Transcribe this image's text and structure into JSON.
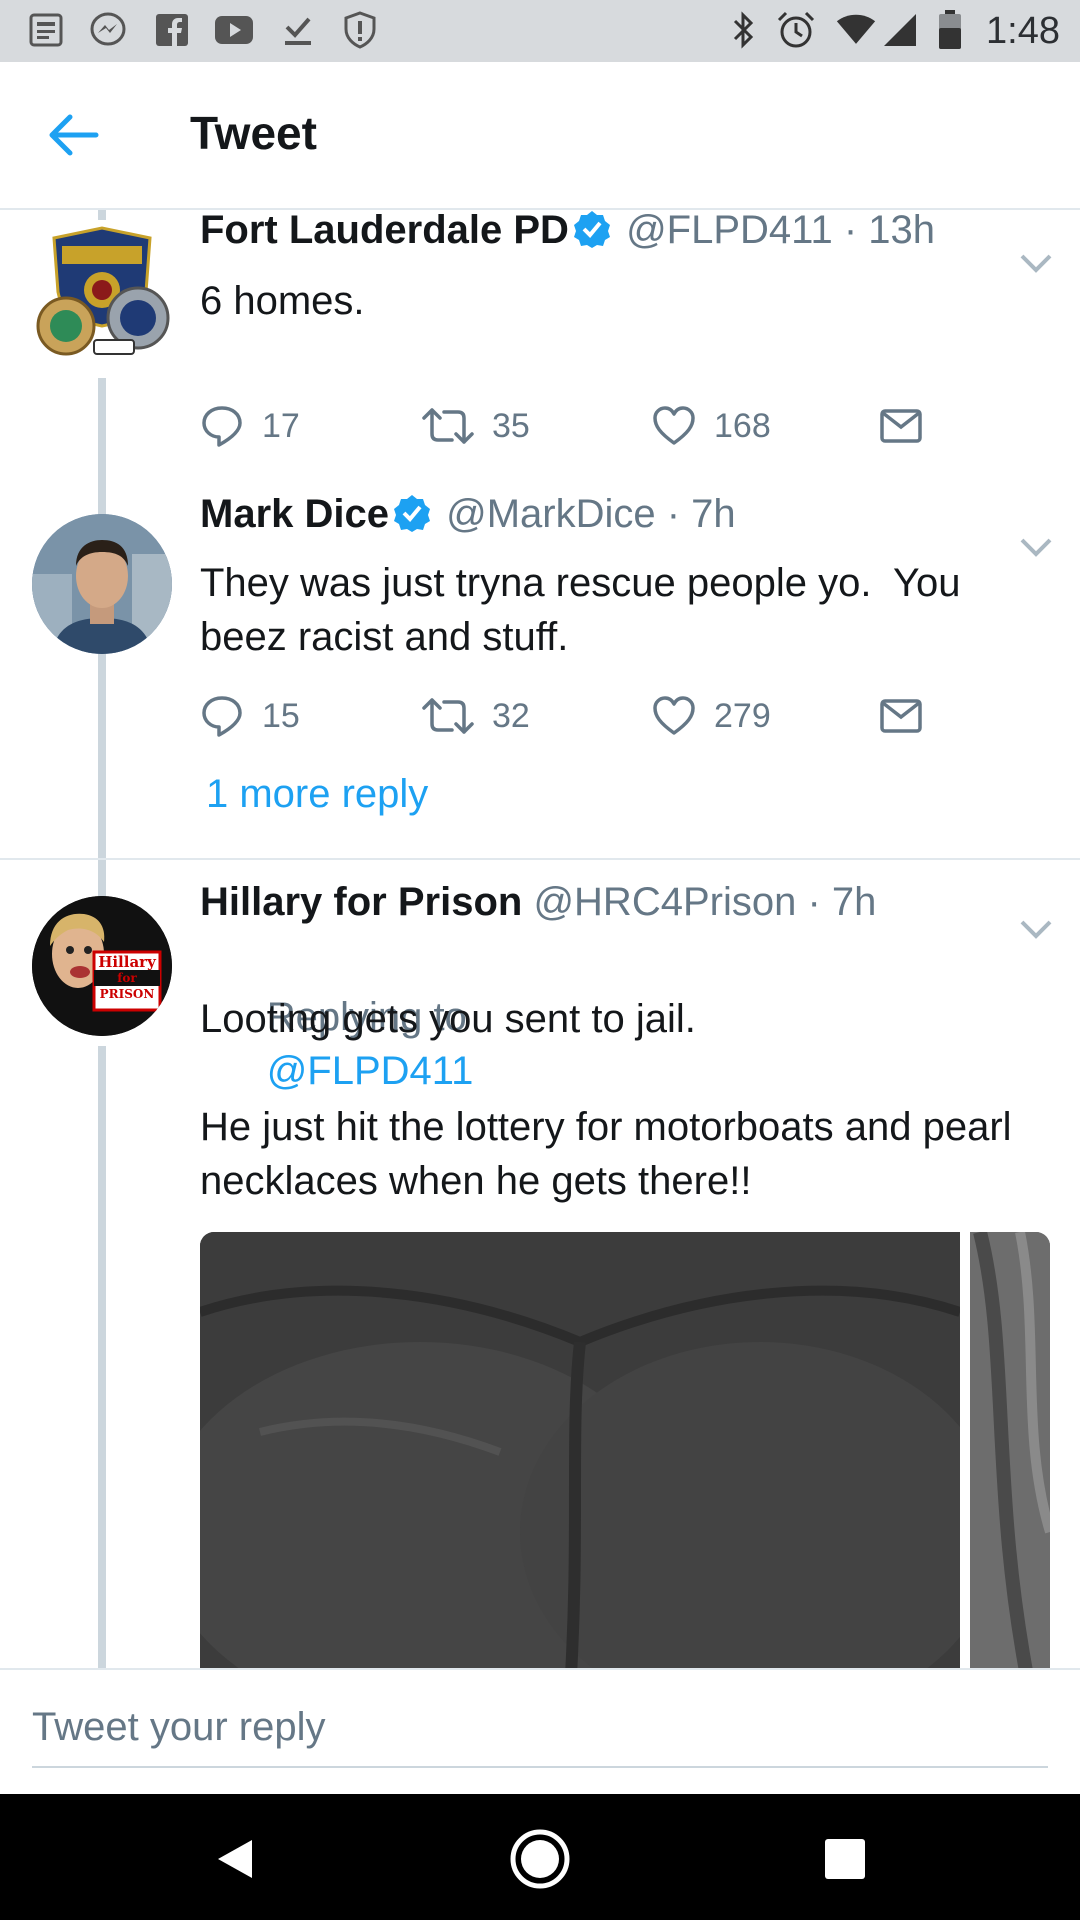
{
  "status_bar": {
    "time": "1:48",
    "left_icons": [
      "news-icon",
      "messenger-icon",
      "facebook-icon",
      "youtube-icon",
      "download-done-icon",
      "shield-alert-icon"
    ],
    "right_icons": [
      "bluetooth-icon",
      "alarm-icon",
      "wifi-icon",
      "signal-icon",
      "battery-icon"
    ]
  },
  "header": {
    "title": "Tweet"
  },
  "colors": {
    "accent": "#1da1f2",
    "secondary_text": "#657786",
    "thread_line": "#ccd6dd",
    "verified": "#1da1f2"
  },
  "tweets": [
    {
      "name": "Fort Lauderdale PD",
      "verified": true,
      "handle": "@FLPD411",
      "time": "· 13h",
      "text": "6 homes.",
      "replies": "17",
      "retweets": "35",
      "likes": "168"
    },
    {
      "name": "Mark Dice",
      "verified": true,
      "handle": "@MarkDice",
      "time": "· 7h",
      "text": "They was just tryna rescue people yo.  You beez racist and stuff.",
      "replies": "15",
      "retweets": "32",
      "likes": "279"
    },
    {
      "name": "Hillary for Prison",
      "verified": false,
      "handle": "@HRC4Prison",
      "time": "· 7h",
      "replying_label": "Replying to",
      "replying_to": "@FLPD411",
      "text": "Looting gets you sent to jail.\n\nHe just hit the lottery for motorboats and pearl necklaces when he gets there!!",
      "avatar_badge": [
        "Hillary",
        "for",
        "PRISON"
      ]
    }
  ],
  "more_reply": "1 more reply",
  "reply_box": {
    "placeholder": "Tweet your reply"
  }
}
